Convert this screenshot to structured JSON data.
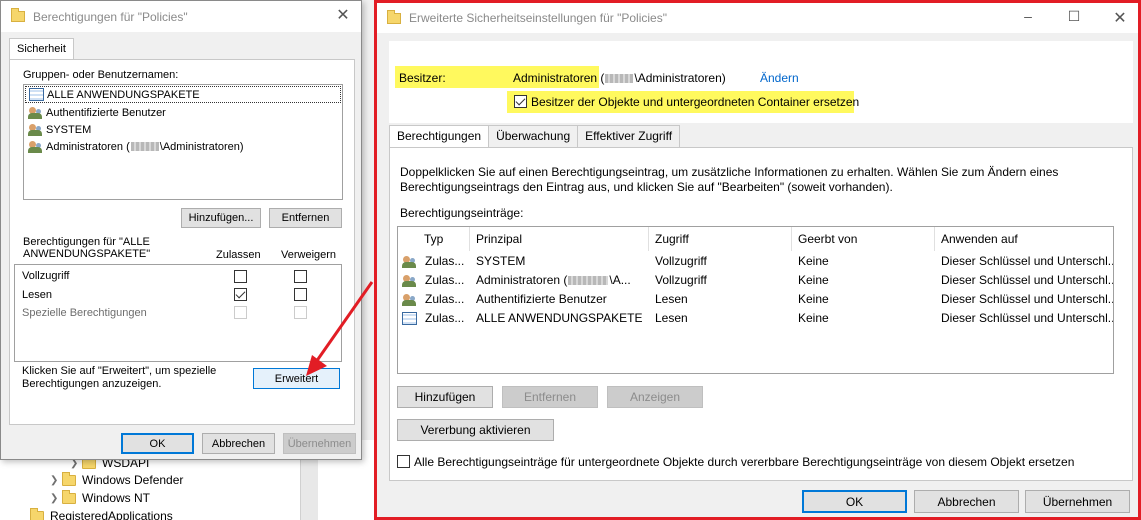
{
  "background": {
    "tree": [
      {
        "label": "WSDAPI"
      },
      {
        "label": "Windows Defender"
      },
      {
        "label": "Windows NT"
      },
      {
        "label": "RegisteredApplications"
      }
    ]
  },
  "left_dialog": {
    "title": "Berechtigungen für \"Policies\"",
    "tab": "Sicherheit",
    "groups_label": "Gruppen- oder Benutzernamen:",
    "groups": [
      {
        "icon": "package-icon",
        "name": "ALLE ANWENDUNGSPAKETE"
      },
      {
        "icon": "users-icon",
        "name": "Authentifizierte Benutzer"
      },
      {
        "icon": "users-icon",
        "name": "SYSTEM"
      },
      {
        "icon": "users-icon",
        "name_prefix": "Administratoren (",
        "name_suffix": "\\Administratoren)"
      }
    ],
    "add_button": "Hinzufügen...",
    "remove_button": "Entfernen",
    "perms_label_line1": "Berechtigungen für \"ALLE",
    "perms_label_line2": "ANWENDUNGSPAKETE\"",
    "allow_header": "Zulassen",
    "deny_header": "Verweigern",
    "permissions": [
      {
        "name": "Vollzugriff",
        "allow": false,
        "deny": false,
        "disabled": false
      },
      {
        "name": "Lesen",
        "allow": true,
        "deny": false,
        "disabled": false
      },
      {
        "name": "Spezielle Berechtigungen",
        "allow": false,
        "deny": false,
        "disabled": true
      }
    ],
    "advanced_hint_line1": "Klicken Sie auf \"Erweitert\", um spezielle",
    "advanced_hint_line2": "Berechtigungen anzuzeigen.",
    "advanced_button": "Erweitert",
    "ok": "OK",
    "cancel": "Abbrechen",
    "apply": "Übernehmen"
  },
  "right_dialog": {
    "title": "Erweiterte Sicherheitseinstellungen für \"Policies\"",
    "owner_label": "Besitzer:",
    "owner_prefix": "Administratoren (",
    "owner_suffix": "\\Administratoren)",
    "change_link": "Ändern",
    "replace_owner_checkbox": "Besitzer der Objekte und untergeordneten Container ersetzen",
    "replace_owner_checked": true,
    "tabs": [
      "Berechtigungen",
      "Überwachung",
      "Effektiver Zugriff"
    ],
    "info_line1": "Doppelklicken Sie auf einen Berechtigungseintrag, um zusätzliche Informationen zu erhalten. Wählen Sie zum Ändern eines",
    "info_line2": "Berechtigungseintrags den Eintrag aus, und klicken Sie auf \"Bearbeiten\" (soweit vorhanden).",
    "entries_label": "Berechtigungseinträge:",
    "columns": [
      "Typ",
      "Prinzipal",
      "Zugriff",
      "Geerbt von",
      "Anwenden auf"
    ],
    "rows": [
      {
        "icon": "users-icon",
        "type": "Zulas...",
        "principal": "SYSTEM",
        "access": "Vollzugriff",
        "inherited": "Keine",
        "applies": "Dieser Schlüssel und Unterschl..."
      },
      {
        "icon": "users-icon",
        "type": "Zulas...",
        "principal_prefix": "Administratoren (",
        "principal_suffix": "\\A...",
        "access": "Vollzugriff",
        "inherited": "Keine",
        "applies": "Dieser Schlüssel und Unterschl..."
      },
      {
        "icon": "users-icon",
        "type": "Zulas...",
        "principal": "Authentifizierte Benutzer",
        "access": "Lesen",
        "inherited": "Keine",
        "applies": "Dieser Schlüssel und Unterschl..."
      },
      {
        "icon": "package-icon",
        "type": "Zulas...",
        "principal": "ALLE ANWENDUNGSPAKETE",
        "access": "Lesen",
        "inherited": "Keine",
        "applies": "Dieser Schlüssel und Unterschl..."
      }
    ],
    "add_button": "Hinzufügen",
    "remove_button": "Entfernen",
    "view_button": "Anzeigen",
    "inheritance_button": "Vererbung aktivieren",
    "replace_all_checkbox": "Alle Berechtigungseinträge für untergeordnete Objekte durch vererbbare Berechtigungseinträge von diesem Objekt ersetzen",
    "replace_all_checked": false,
    "ok": "OK",
    "cancel": "Abbrechen",
    "apply": "Übernehmen"
  },
  "colors": {
    "highlight_border": "#e21d25",
    "annotation_arrow": "#e21d25",
    "owner_highlight": "#fff95e",
    "link": "#0066cc"
  }
}
